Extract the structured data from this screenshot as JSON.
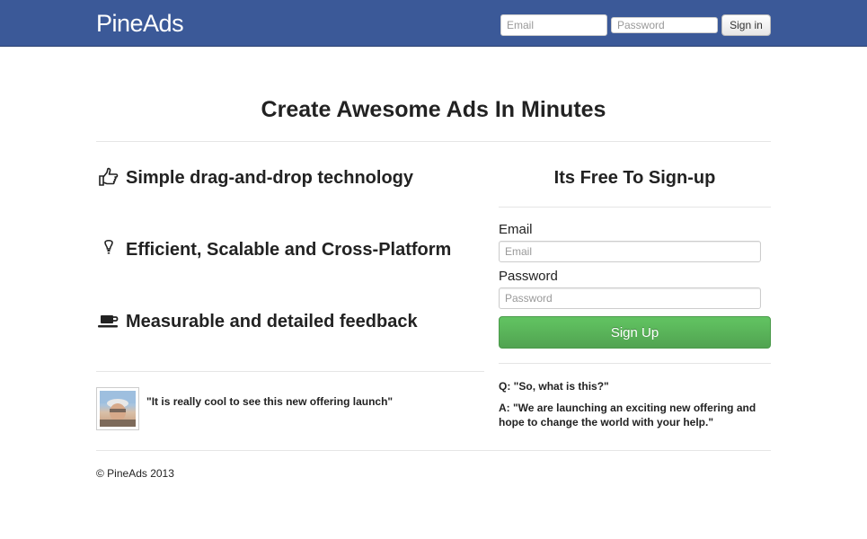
{
  "header": {
    "brand": "PineAds",
    "email_placeholder": "Email",
    "password_placeholder": "Password",
    "signin_label": "Sign in",
    "bg_color": "#3b5998"
  },
  "hero": {
    "title": "Create Awesome Ads In Minutes"
  },
  "features": [
    {
      "icon": "hand-pointing-icon",
      "text": "Simple drag-and-drop technology"
    },
    {
      "icon": "lightbulb-icon",
      "text": "Efficient, Scalable and Cross-Platform"
    },
    {
      "icon": "coffee-cup-icon",
      "text": "Measurable and detailed feedback"
    }
  ],
  "testimonial": {
    "quote": "\"It is really cool to see this new offering launch\""
  },
  "signup": {
    "title": "Its Free To Sign-up",
    "email_label": "Email",
    "email_placeholder": "Email",
    "password_label": "Password",
    "password_placeholder": "Password",
    "button_label": "Sign Up",
    "button_color": "#5bb75b"
  },
  "faq": {
    "question": "Q: \"So, what is this?\"",
    "answer": "A: \"We are launching an exciting new offering and hope to change the world with your help.\""
  },
  "footer": {
    "copyright": "© PineAds 2013"
  }
}
